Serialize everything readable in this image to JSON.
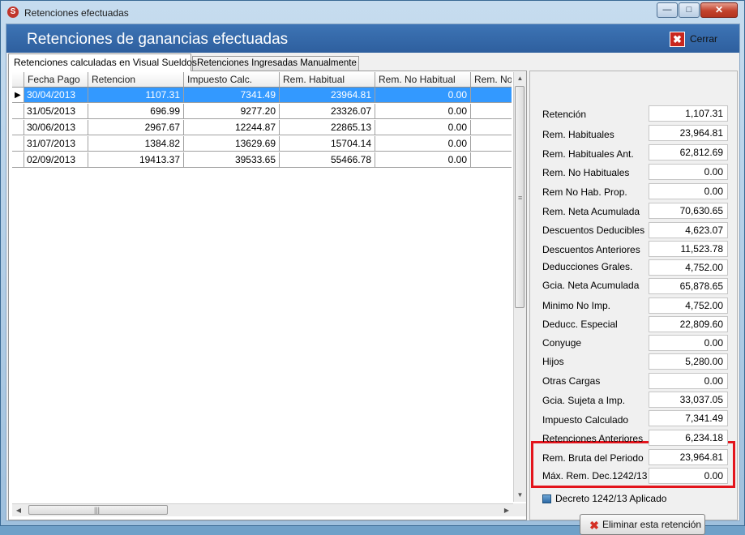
{
  "window": {
    "title": "Retenciones efectuadas",
    "close_glyph": "✕",
    "maximize_glyph": "□",
    "minimize_glyph": "—"
  },
  "header": {
    "title": "Retenciones de ganancias efectuadas",
    "close_label": "Cerrar"
  },
  "tabs": [
    {
      "label": "Retenciones calculadas en Visual Sueldos"
    },
    {
      "label": "Retenciones Ingresadas Manualmente"
    }
  ],
  "table": {
    "columns": [
      "Fecha Pago",
      "Retencion",
      "Impuesto Calc.",
      "Rem. Habitual",
      "Rem. No Habitual",
      "Rem. No"
    ],
    "rows": [
      [
        "30/04/2013",
        "1107.31",
        "7341.49",
        "23964.81",
        "0.00",
        ""
      ],
      [
        "31/05/2013",
        "696.99",
        "9277.20",
        "23326.07",
        "0.00",
        ""
      ],
      [
        "30/06/2013",
        "2967.67",
        "12244.87",
        "22865.13",
        "0.00",
        ""
      ],
      [
        "31/07/2013",
        "1384.82",
        "13629.69",
        "15704.14",
        "0.00",
        ""
      ],
      [
        "02/09/2013",
        "19413.37",
        "39533.65",
        "55466.78",
        "0.00",
        ""
      ]
    ],
    "selected_row": 0
  },
  "summary": [
    {
      "label": "Retención",
      "value": "1,107.31"
    },
    {
      "label": "Rem. Habituales",
      "value": "23,964.81"
    },
    {
      "label": "Rem. Habituales Ant.",
      "value": "62,812.69"
    },
    {
      "label": "Rem. No Habituales",
      "value": "0.00"
    },
    {
      "label": "Rem No Hab. Prop.",
      "value": "0.00"
    },
    {
      "label": "Rem. Neta Acumulada",
      "value": "70,630.65"
    },
    {
      "label": "Descuentos Deducibles",
      "value": "4,623.07"
    },
    {
      "label": "Descuentos Anteriores",
      "value": "11,523.78"
    },
    {
      "label": "Deducciones Grales.",
      "value": "4,752.00"
    },
    {
      "label": "Gcia. Neta Acumulada",
      "value": "65,878.65"
    },
    {
      "label": "Minimo No Imp.",
      "value": "4,752.00"
    },
    {
      "label": "Deducc. Especial",
      "value": "22,809.60"
    },
    {
      "label": "Conyuge",
      "value": "0.00"
    },
    {
      "label": "Hijos",
      "value": "5,280.00"
    },
    {
      "label": "Otras Cargas",
      "value": "0.00"
    },
    {
      "label": "Gcia. Sujeta a Imp.",
      "value": "33,037.05"
    },
    {
      "label": "Impuesto Calculado",
      "value": "7,341.49"
    },
    {
      "label": "Retenciones Anteriores",
      "value": "6,234.18"
    },
    {
      "label": "Rem. Bruta del Periodo",
      "value": "23,964.81"
    },
    {
      "label": "Máx. Rem. Dec.1242/13",
      "value": "0.00"
    }
  ],
  "decreto_checkbox": {
    "label": "Decreto 1242/13 Aplicado"
  },
  "delete_button": {
    "label": "Eliminar esta retención",
    "icon_glyph": "✖"
  },
  "row_indicator_glyph": "▶",
  "scroll_glyphs": {
    "up": "▲",
    "down": "▼",
    "left": "◀",
    "right": "▶",
    "vgrip": "≡",
    "hgrip": "|||"
  },
  "icon_glyphs": {
    "app": "S",
    "close": "✖"
  },
  "colors": {
    "header": "#2e5f9e",
    "selected_row": "#3399ff",
    "highlight_border": "#e3141c"
  }
}
